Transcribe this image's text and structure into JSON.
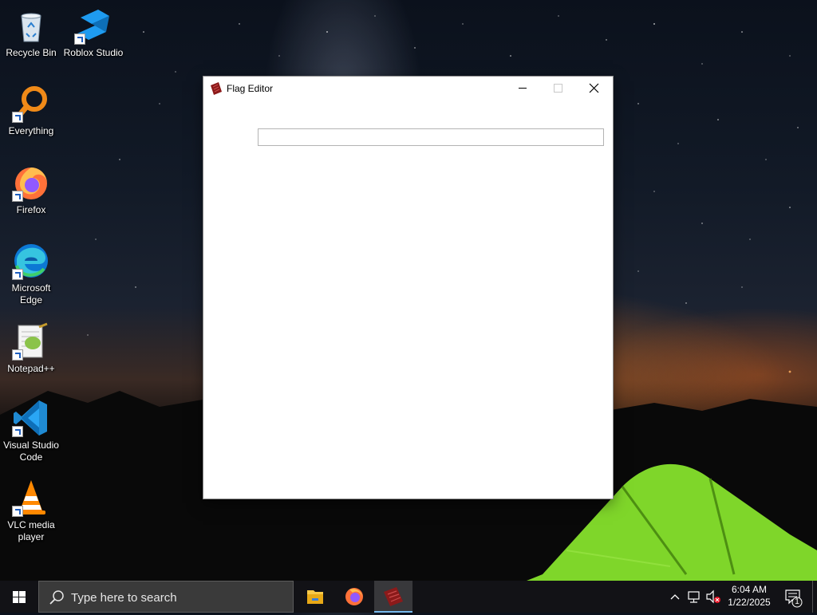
{
  "desktop": {
    "icons": [
      {
        "label": "Recycle Bin",
        "icon": "recycle-bin-icon"
      },
      {
        "label": "Roblox Studio",
        "icon": "roblox-studio-icon"
      },
      {
        "label": "Everything",
        "icon": "everything-search-icon"
      },
      {
        "label": "Firefox",
        "icon": "firefox-icon"
      },
      {
        "label": "Microsoft Edge",
        "icon": "edge-icon"
      },
      {
        "label": "Notepad++",
        "icon": "notepadpp-icon"
      },
      {
        "label": "Visual Studio Code",
        "icon": "vscode-icon"
      },
      {
        "label": "VLC media player",
        "icon": "vlc-icon"
      }
    ]
  },
  "window": {
    "title": "Flag Editor",
    "input_value": "",
    "colors": {
      "icon": "#8b1a1a"
    }
  },
  "taskbar": {
    "search_placeholder": "Type here to search",
    "apps": [
      "file-explorer-icon",
      "firefox-icon",
      "flag-editor-icon"
    ],
    "clock": {
      "time": "6:04 AM",
      "date": "1/22/2025"
    },
    "notification_count": "1"
  }
}
